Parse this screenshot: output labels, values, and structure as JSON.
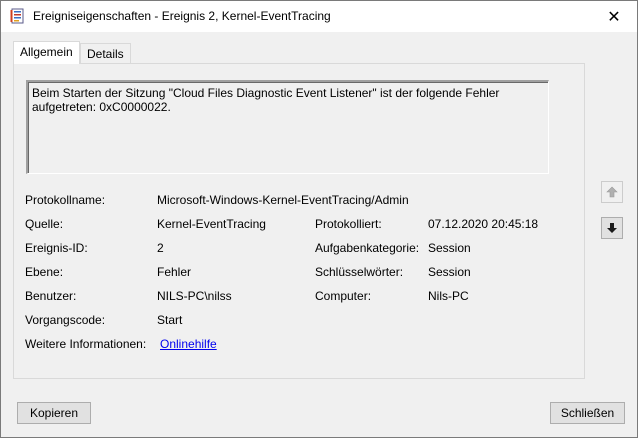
{
  "window": {
    "title": "Ereigniseigenschaften - Ereignis 2, Kernel-EventTracing",
    "close_glyph": "✕"
  },
  "tabs": [
    {
      "label": "Allgemein",
      "active": true
    },
    {
      "label": "Details",
      "active": false
    }
  ],
  "message": "Beim Starten der Sitzung \"Cloud Files Diagnostic Event Listener\" ist der folgende Fehler aufgetreten: 0xC0000022.",
  "fields": {
    "protokollname": {
      "label": "Protokollname:",
      "value": "Microsoft-Windows-Kernel-EventTracing/Admin"
    },
    "quelle": {
      "label": "Quelle:",
      "value": "Kernel-EventTracing"
    },
    "protokolliert": {
      "label": "Protokolliert:",
      "value": "07.12.2020 20:45:18"
    },
    "ereignis_id": {
      "label": "Ereignis-ID:",
      "value": "2"
    },
    "aufgabenkategorie": {
      "label": "Aufgabenkategorie:",
      "value": "Session"
    },
    "ebene": {
      "label": "Ebene:",
      "value": "Fehler"
    },
    "schluesselwoerter": {
      "label": "Schlüsselwörter:",
      "value": "Session"
    },
    "benutzer": {
      "label": "Benutzer:",
      "value": "NILS-PC\\nilss"
    },
    "computer": {
      "label": "Computer:",
      "value": "Nils-PC"
    },
    "vorgangscode": {
      "label": "Vorgangscode:",
      "value": "Start"
    },
    "weitere_informationen": {
      "label": "Weitere Informationen:",
      "link": "Onlinehilfe"
    }
  },
  "nav": {
    "up_icon": "arrow-up-icon",
    "down_icon": "arrow-down-icon"
  },
  "buttons": {
    "copy": "Kopieren",
    "close": "Schließen"
  },
  "colors": {
    "link": "#0000ee",
    "titlebar": "#ffffff",
    "window_bg": "#f0f0f0"
  }
}
